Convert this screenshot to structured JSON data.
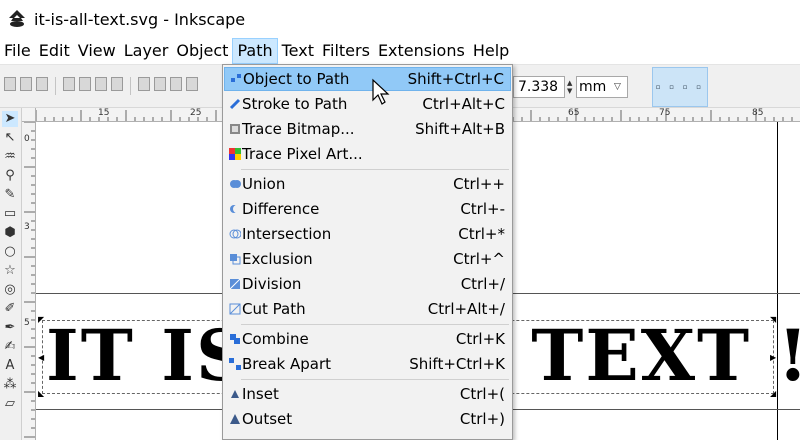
{
  "window": {
    "title": "it-is-all-text.svg - Inkscape"
  },
  "menubar": {
    "items": [
      "File",
      "Edit",
      "View",
      "Layer",
      "Object",
      "Path",
      "Text",
      "Filters",
      "Extensions",
      "Help"
    ],
    "active": "Path"
  },
  "toolbar": {
    "value": "7.338",
    "unit": "mm"
  },
  "ruler": {
    "top_labels": [
      "15",
      "25",
      "65",
      "75",
      "85"
    ],
    "left_labels": [
      "0",
      "3",
      "5"
    ]
  },
  "canvas": {
    "text_left": "IT IS",
    "text_right": "TEXT !"
  },
  "path_menu": {
    "items": [
      {
        "label": "Object to Path",
        "shortcut": "Shift+Ctrl+C",
        "icon": "object-to-path-icon",
        "highlighted": true
      },
      {
        "label": "Stroke to Path",
        "shortcut": "Ctrl+Alt+C",
        "icon": "stroke-to-path-icon"
      },
      {
        "label": "Trace Bitmap...",
        "shortcut": "Shift+Alt+B",
        "icon": "trace-bitmap-icon"
      },
      {
        "label": "Trace Pixel Art...",
        "shortcut": "",
        "icon": "trace-pixel-art-icon"
      },
      {
        "label": "Union",
        "shortcut": "Ctrl++",
        "icon": "union-icon"
      },
      {
        "label": "Difference",
        "shortcut": "Ctrl+-",
        "icon": "difference-icon"
      },
      {
        "label": "Intersection",
        "shortcut": "Ctrl+*",
        "icon": "intersection-icon"
      },
      {
        "label": "Exclusion",
        "shortcut": "Ctrl+^",
        "icon": "exclusion-icon"
      },
      {
        "label": "Division",
        "shortcut": "Ctrl+/",
        "icon": "division-icon"
      },
      {
        "label": "Cut Path",
        "shortcut": "Ctrl+Alt+/",
        "icon": "cut-path-icon"
      },
      {
        "label": "Combine",
        "shortcut": "Ctrl+K",
        "icon": "combine-icon"
      },
      {
        "label": "Break Apart",
        "shortcut": "Shift+Ctrl+K",
        "icon": "break-apart-icon"
      },
      {
        "label": "Inset",
        "shortcut": "Ctrl+(",
        "icon": "inset-icon"
      },
      {
        "label": "Outset",
        "shortcut": "Ctrl+)",
        "icon": "outset-icon"
      }
    ]
  },
  "colors": {
    "menu_highlight": "#91c9f7",
    "menubar_active": "#cce8ff",
    "menu_bg": "#f2f2f2"
  }
}
